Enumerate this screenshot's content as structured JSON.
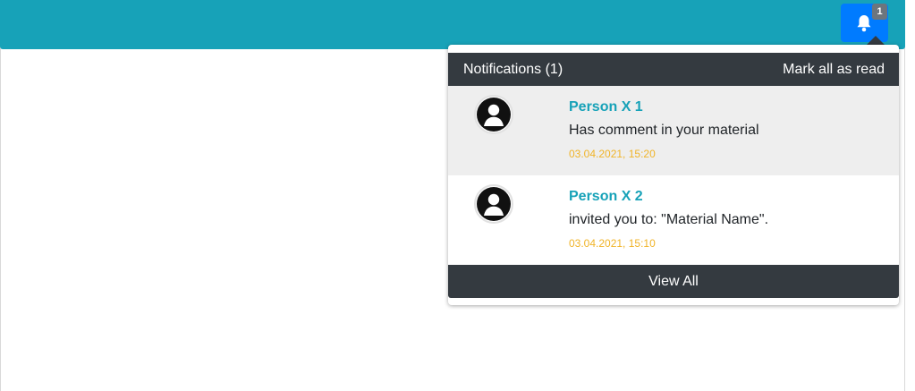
{
  "colors": {
    "topbar": "#17a2b8",
    "bell_button": "#007bff",
    "badge": "#6c757d",
    "dropdown_header": "#343a40",
    "name_text": "#17a2b8",
    "timestamp_text": "#f0b429",
    "unread_row": "#eeeeee"
  },
  "topbar": {
    "bell_icon": "bell-icon",
    "badge_count": "1"
  },
  "notifications_panel": {
    "title": "Notifications (1)",
    "mark_all_label": "Mark all as read",
    "items": [
      {
        "avatar_icon": "user-avatar-icon",
        "name": "Person X 1",
        "message": "Has comment in your material",
        "timestamp": "03.04.2021, 15:20",
        "unread": true
      },
      {
        "avatar_icon": "user-avatar-icon",
        "name": "Person X 2",
        "message": "invited you to: \"Material Name\".",
        "timestamp": "03.04.2021, 15:10",
        "unread": false
      }
    ],
    "view_all_label": "View All"
  }
}
